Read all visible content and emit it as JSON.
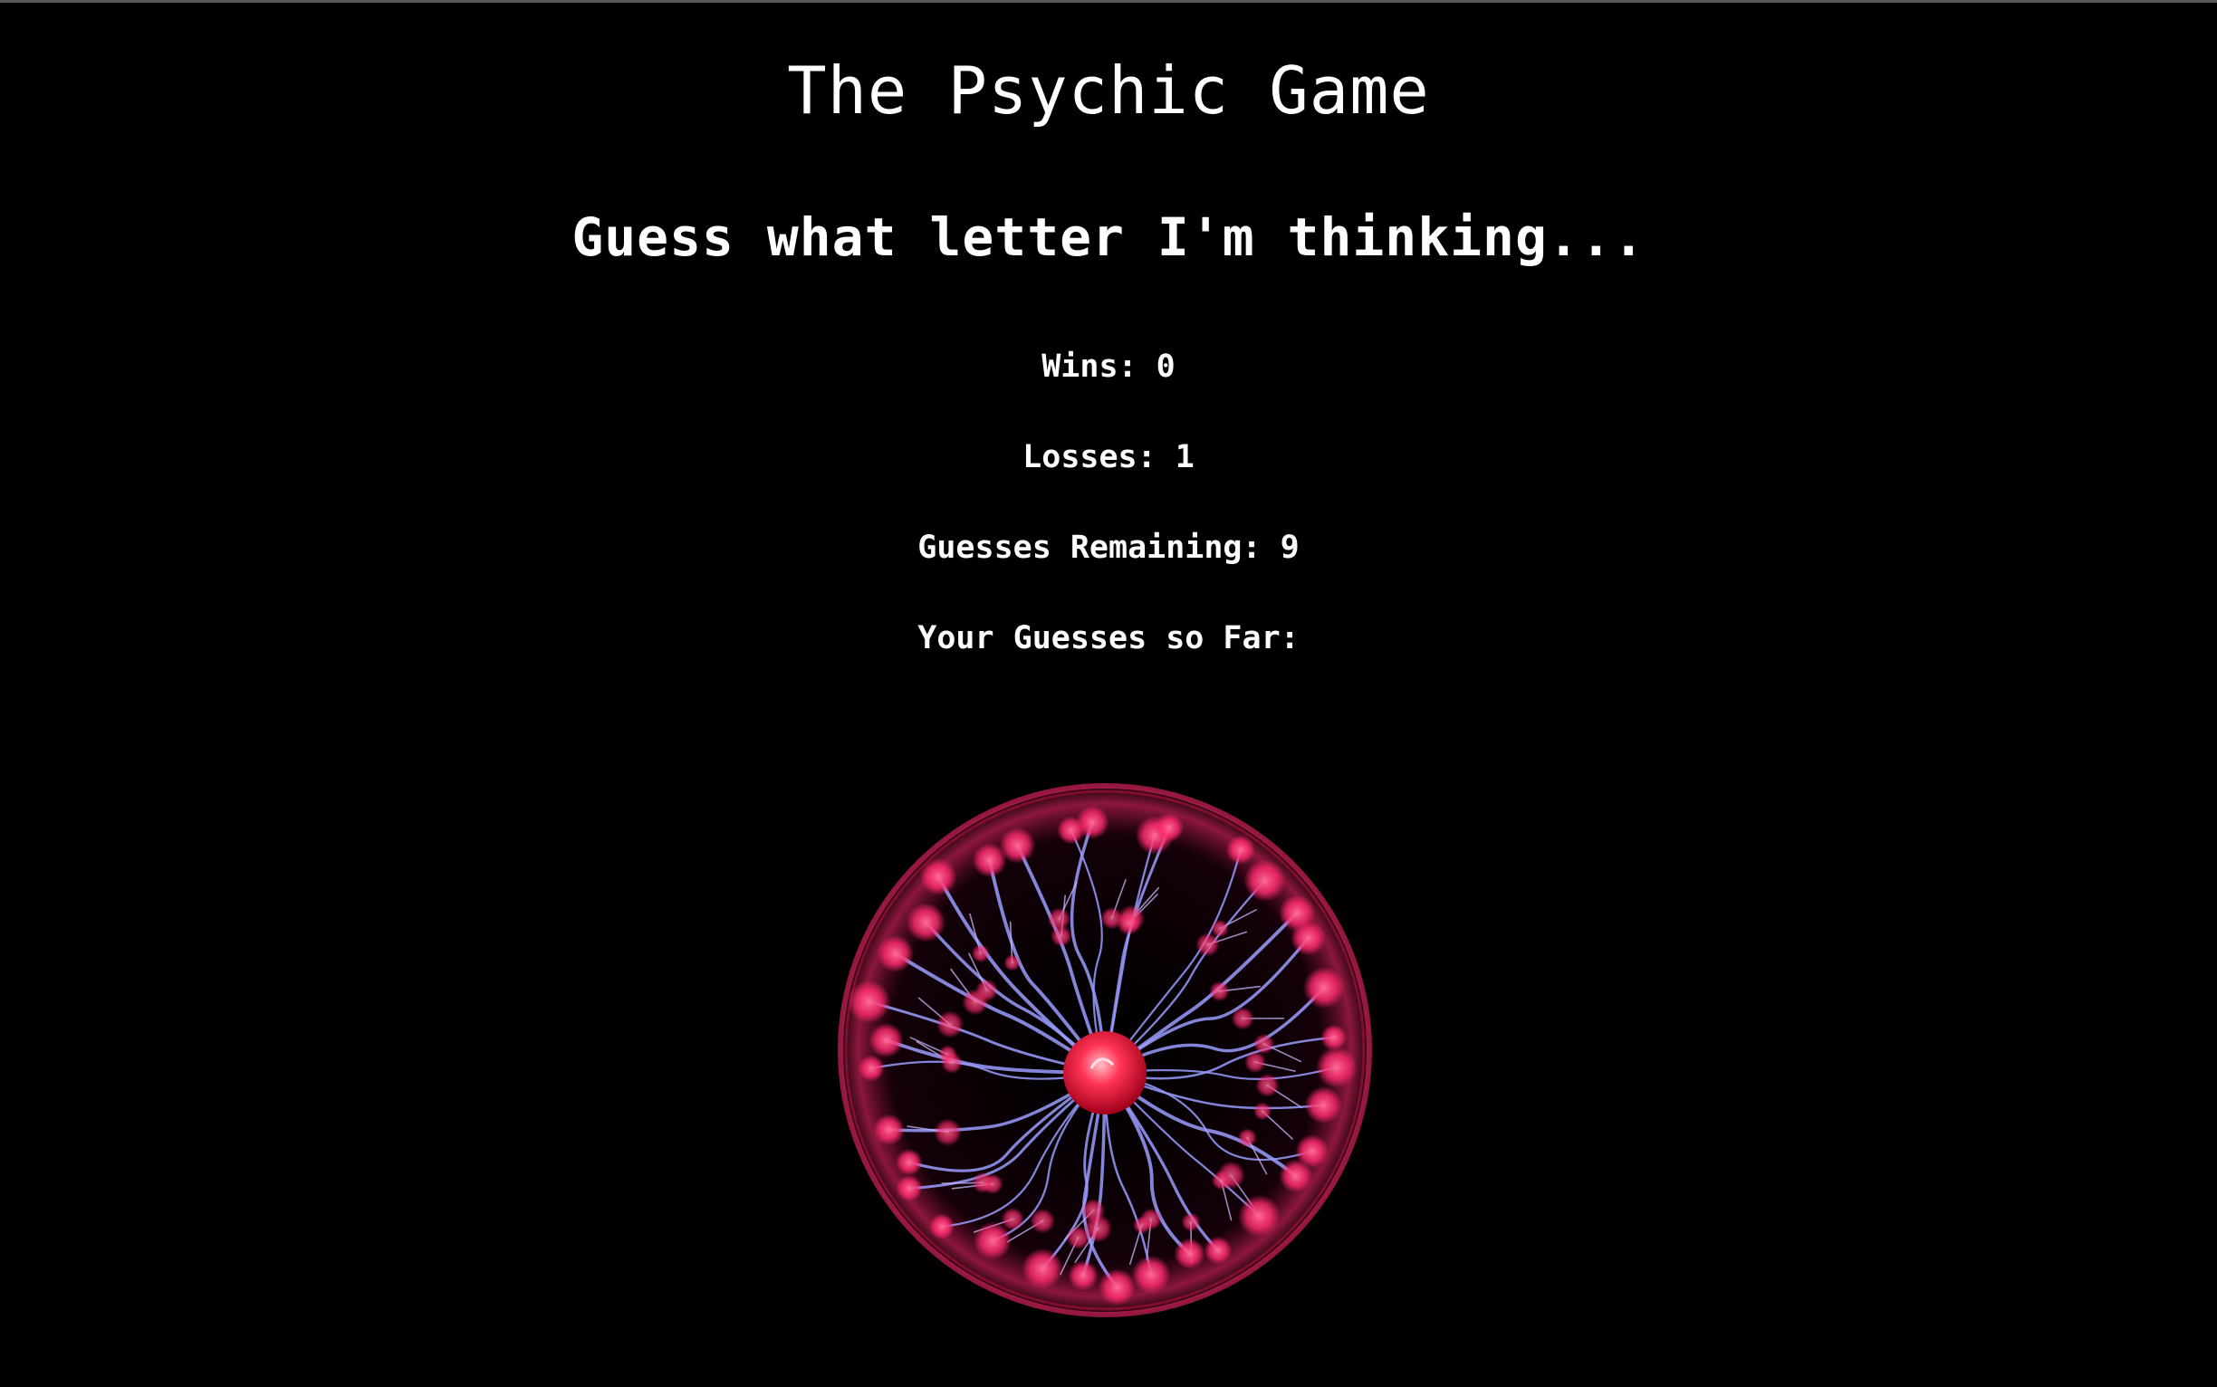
{
  "game": {
    "title": "The Psychic Game",
    "subtitle": "Guess what letter I'm thinking...",
    "wins_label": "Wins: 0",
    "losses_label": "Losses: 1",
    "remaining_label": "Guesses Remaining: 9",
    "guesses_label": "Your Guesses so Far:"
  },
  "image": {
    "icon": "plasma-ball-image",
    "colors": {
      "background": "#000000",
      "plasma_pink": "#ff2a6d",
      "plasma_blue": "#8c8cff",
      "core_red": "#ff3355"
    }
  }
}
